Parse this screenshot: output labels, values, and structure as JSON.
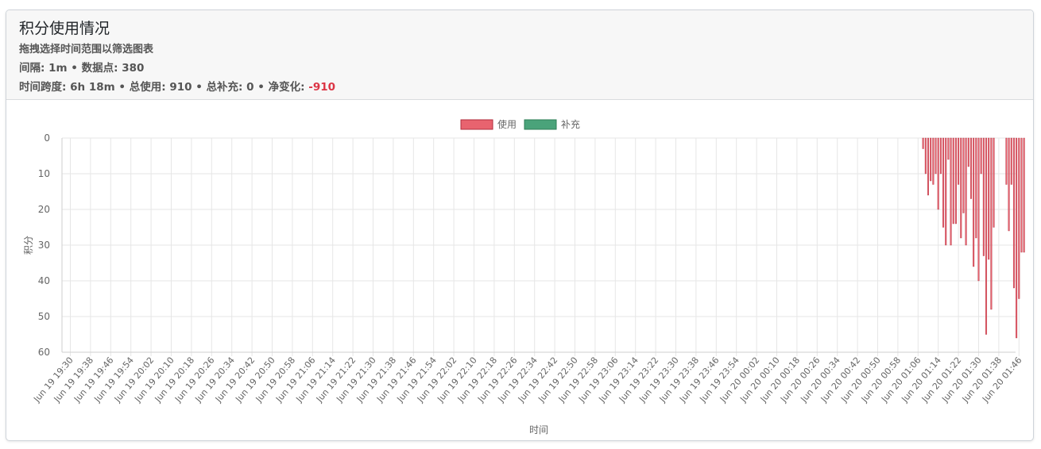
{
  "header": {
    "title": "积分使用情况",
    "subtitle": "拖拽选择时间范围以筛选图表",
    "interval_label": "间隔:",
    "interval_value": "1m",
    "points_label": "数据点:",
    "points_value": "380",
    "span_label": "时间跨度:",
    "span_value": "6h 18m",
    "used_label": "总使用:",
    "used_value": "910",
    "refill_label": "总补充:",
    "refill_value": "0",
    "net_label": "净变化:",
    "net_value": "-910",
    "separator": "•"
  },
  "colors": {
    "used": "#e8636f",
    "used_border": "#b12c3c",
    "refill": "#4aa37a",
    "refill_border": "#2e7d56",
    "grid": "#e6e6e6",
    "tick": "#666666",
    "negative": "#dc3545"
  },
  "chart_data": {
    "type": "bar",
    "title": "",
    "xlabel": "时间",
    "ylabel": "积分",
    "legend_position": "top-center",
    "grid": true,
    "y_reversed": true,
    "ylim": [
      0,
      60
    ],
    "yticks": [
      0,
      10,
      20,
      30,
      40,
      50,
      60
    ],
    "x_tick_labels": [
      "Jun 19 19:30",
      "Jun 19 19:38",
      "Jun 19 19:46",
      "Jun 19 19:54",
      "Jun 19 20:02",
      "Jun 19 20:10",
      "Jun 19 20:18",
      "Jun 19 20:26",
      "Jun 19 20:34",
      "Jun 19 20:42",
      "Jun 19 20:50",
      "Jun 19 20:58",
      "Jun 19 21:06",
      "Jun 19 21:14",
      "Jun 19 21:22",
      "Jun 19 21:30",
      "Jun 19 21:38",
      "Jun 19 21:46",
      "Jun 19 21:54",
      "Jun 19 22:02",
      "Jun 19 22:10",
      "Jun 19 22:18",
      "Jun 19 22:26",
      "Jun 19 22:34",
      "Jun 19 22:42",
      "Jun 19 22:50",
      "Jun 19 22:58",
      "Jun 19 23:06",
      "Jun 19 23:14",
      "Jun 19 23:22",
      "Jun 19 23:30",
      "Jun 19 23:38",
      "Jun 19 23:46",
      "Jun 19 23:54",
      "Jun 20 00:02",
      "Jun 20 00:10",
      "Jun 20 00:18",
      "Jun 20 00:26",
      "Jun 20 00:34",
      "Jun 20 00:42",
      "Jun 20 00:50",
      "Jun 20 00:58",
      "Jun 20 01:06",
      "Jun 20 01:14",
      "Jun 20 01:22",
      "Jun 20 01:30",
      "Jun 20 01:38",
      "Jun 20 01:46"
    ],
    "series": [
      {
        "name": "使用",
        "x": [
          "Jun 20 01:08",
          "Jun 20 01:09",
          "Jun 20 01:10",
          "Jun 20 01:11",
          "Jun 20 01:12",
          "Jun 20 01:13",
          "Jun 20 01:14",
          "Jun 20 01:15",
          "Jun 20 01:16",
          "Jun 20 01:17",
          "Jun 20 01:18",
          "Jun 20 01:19",
          "Jun 20 01:20",
          "Jun 20 01:21",
          "Jun 20 01:22",
          "Jun 20 01:23",
          "Jun 20 01:24",
          "Jun 20 01:25",
          "Jun 20 01:26",
          "Jun 20 01:27",
          "Jun 20 01:28",
          "Jun 20 01:29",
          "Jun 20 01:30",
          "Jun 20 01:31",
          "Jun 20 01:32",
          "Jun 20 01:33",
          "Jun 20 01:34",
          "Jun 20 01:35",
          "Jun 20 01:36",
          "Jun 20 01:41",
          "Jun 20 01:42",
          "Jun 20 01:43",
          "Jun 20 01:44",
          "Jun 20 01:45",
          "Jun 20 01:46",
          "Jun 20 01:47",
          "Jun 20 01:48"
        ],
        "values": [
          3,
          10,
          16,
          12,
          13,
          10,
          20,
          10,
          25,
          30,
          6,
          30,
          24,
          24,
          13,
          28,
          21,
          30,
          8,
          17,
          36,
          28,
          40,
          10,
          33,
          55,
          34,
          48,
          25,
          13,
          26,
          13,
          42,
          56,
          45,
          32,
          32
        ]
      },
      {
        "name": "补充",
        "x": [],
        "values": []
      }
    ]
  }
}
